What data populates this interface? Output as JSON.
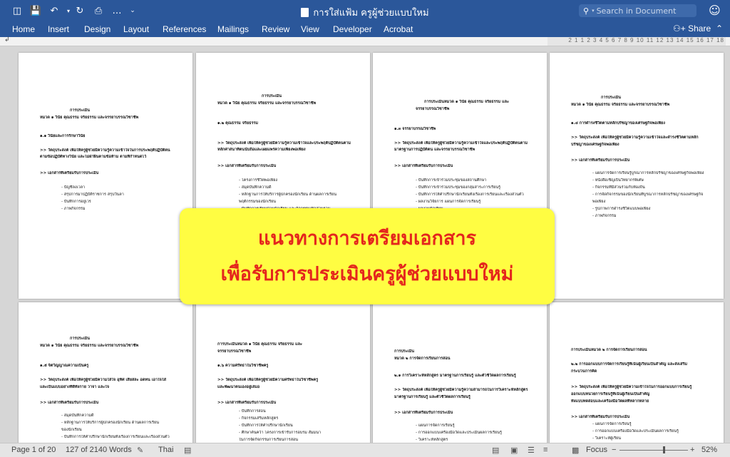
{
  "window": {
    "title": "การใส่แฟ้ม ครูผู้ช่วยแบบใหม่",
    "search_placeholder": "Search in Document",
    "quick_access": [
      "sidebar-toggle-icon",
      "save-icon",
      "undo-icon",
      "redo-icon",
      "print-icon",
      "customize-icon"
    ]
  },
  "ribbon": {
    "tabs": [
      "Home",
      "Insert",
      "Design",
      "Layout",
      "References",
      "Mailings",
      "Review",
      "View",
      "Developer",
      "Acrobat"
    ],
    "share_label": "Share"
  },
  "ruler": {
    "numbers": "2 1 1 2 3 4 5 6 7 8 9 10 11 12 13 14 15 16 17 18"
  },
  "pages": [
    {
      "lines": [
        {
          "t": "การประเมิน",
          "b": true
        },
        {
          "t": "หมวด ๑ วินัย คุณธรรม จริยธรรม และจรรยาบรรณวิชาชีพ",
          "b": true
        },
        {
          "t": "๑.๑ วินัยและการรักษาวินัย",
          "b": true
        },
        {
          "t": ">> วัตถุประสงค์    เพื่อให้ครูผู้ช่วยมีความรู้ความเข้าใจในการประพฤติปฏิบัติตน",
          "b": true
        },
        {
          "t": "ตามข้อปฏิบัติทางวินัย และไม่ฝ่าฝืนตามข้อห้าม ตามที่กำหนดไว้",
          "b": true
        },
        {
          "t": ">> เอกสารที่เตรียมรับการประเมิน",
          "b": true
        },
        {
          "t": "- บัญชีลงเวลา",
          "b": false
        },
        {
          "t": "- สรุปการมาปฏิบัติราชการ สรุปวันลา",
          "b": false
        },
        {
          "t": "- บันทึกการอยู่เวร",
          "b": false
        },
        {
          "t": "- ภาพกิจกรรม",
          "b": false
        }
      ]
    },
    {
      "lines": [
        {
          "t": "การประเมิน",
          "b": true
        },
        {
          "t": "หมวด ๑ วินัย คุณธรรม จริยธรรม และจรรยาบรรณวิชาชีพ",
          "b": true
        },
        {
          "t": "๑.๒ คุณธรรม จริยธรรม",
          "b": true
        },
        {
          "t": ">> วัตถุประสงค์    เพื่อให้ครูผู้ช่วยมีความรู้ความเข้าใจและประพฤติปฏิบัติตนตาม",
          "b": true
        },
        {
          "t": "หลักศาสนาที่ตนนับถือและเผยแพร่ความเพียงพอเพียง",
          "b": true
        },
        {
          "t": ">> เอกสารที่เตรียมรับการประเมิน",
          "b": true
        },
        {
          "t": "- โครงการชีวิตพอเพียง",
          "b": false
        },
        {
          "t": "- สมุดบันทึกความดี",
          "b": false
        },
        {
          "t": "- หลักฐานการให้บริการผู้ปกครองนักเรียน ด้านผลการเรียน",
          "b": false
        },
        {
          "t": "  พฤติกรรมของนักเรียน",
          "b": false
        },
        {
          "t": "- บันทึกการเยี่ยมบ้านนักเรียน และกิจกรรมเพื่อส่วนรวม",
          "b": false
        }
      ]
    },
    {
      "lines": [
        {
          "t": "การประเมินหมวด ๑ วินัย คุณธรรม จริยธรรม และ",
          "b": true
        },
        {
          "t": "จรรยาบรรณวิชาชีพ",
          "b": true
        },
        {
          "t": "๑.๓ จรรยาบรรณวิชาชีพ",
          "b": true
        },
        {
          "t": ">> วัตถุประสงค์    เพื่อให้ครูผู้ช่วยมีความรู้ความเข้าใจและประพฤติปฏิบัติตนตาม",
          "b": true
        },
        {
          "t": "มาตรฐานการปฏิบัติตน และจรรยาบรรณวิชาชีพ",
          "b": true
        },
        {
          "t": ">> เอกสารที่เตรียมรับการประเมิน",
          "b": true
        },
        {
          "t": "- บันทึกการเข้าร่วมประชุมของสถานศึกษา",
          "b": false
        },
        {
          "t": "- บันทึกการเข้าร่วมประชุมของกลุ่มสาระการเรียนรู้",
          "b": false
        },
        {
          "t": "- บันทึกการให้คำปรึกษานักเรียนทั้งเรื่องการเรียนและเรื่องส่วนตัว",
          "b": false
        },
        {
          "t": "- ผลงานวิจัยการ แผนการจัดการเรียนรู้",
          "b": false
        },
        {
          "t": "- ผลงานนักเรียน",
          "b": false
        }
      ]
    },
    {
      "lines": [
        {
          "t": "การประเมิน",
          "b": true
        },
        {
          "t": "หมวด ๑ วินัย คุณธรรม จริยธรรม และจรรยาบรรณวิชาชีพ",
          "b": true
        },
        {
          "t": "๑.๔ การดำรงชีวิตตามหลักปรัชญาของเศรษฐกิจพอเพียง",
          "b": true
        },
        {
          "t": ">> วัตถุประสงค์    เพื่อให้ครูผู้ช่วยมีความรู้ความเข้าใจและดำรงชีวิตตามหลัก",
          "b": true
        },
        {
          "t": "ปรัชญาของเศรษฐกิจพอเพียง",
          "b": true
        },
        {
          "t": ">> เอกสารที่เตรียมรับการประเมิน",
          "b": true
        },
        {
          "t": "- แผนการจัดการเรียนรู้บูรณาการหลักปรัชญาของเศรษฐกิจพอเพียง",
          "b": false
        },
        {
          "t": "- หนังสือเชิญเป็นวิทยากรพิเศษ",
          "b": false
        },
        {
          "t": "- กิจกรรมที่มีส่วนร่วมกับท้องถิ่น",
          "b": false
        },
        {
          "t": "- การจัดกิจกรรมของนักเรียนที่บูรณาการหลักปรัชญาของเศรษฐกิจ",
          "b": false
        },
        {
          "t": "  พอเพียง",
          "b": false
        },
        {
          "t": "- รูปภาพการดำรงชีวิตแบบพอเพียง",
          "b": false
        },
        {
          "t": "- ภาพกิจกรรม",
          "b": false
        }
      ]
    },
    {
      "lines": [
        {
          "t": "การประเมิน",
          "b": true
        },
        {
          "t": "หมวด ๑ วินัย คุณธรรม จริยธรรม และจรรยาบรรณวิชาชีพ",
          "b": true
        },
        {
          "t": "๑.๕ จิตวิญญาณความเป็นครู",
          "b": true
        },
        {
          "t": ">> วัตถุประสงค์    เพื่อให้ครูผู้ช่วยมีความใส่ใจ อุทิศ เสียสละ อดทน เอาใจใส่",
          "b": true
        },
        {
          "t": "และเป็นแบบอย่างที่ดีทั้งกาย วาจา และใจ",
          "b": true
        },
        {
          "t": ">> เอกสารที่เตรียมรับการประเมิน",
          "b": true
        },
        {
          "t": "- สมุดบันทึกความดี",
          "b": false
        },
        {
          "t": "- หลักฐานการให้บริการผู้ปกครองนักเรียน ด้านผลการเรียน",
          "b": false
        },
        {
          "t": "  ของนักเรียน",
          "b": false
        },
        {
          "t": "- บันทึกการให้คำปรึกษานักเรียนทั้งเรื่องการเรียนและเรื่องส่วนตัว",
          "b": false
        }
      ]
    },
    {
      "lines": [
        {
          "t": "การประเมินหมวด ๑ วินัย คุณธรรม จริยธรรม และ",
          "b": true
        },
        {
          "t": "จรรยาบรรณวิชาชีพ",
          "b": true
        },
        {
          "t": "๑.๖ ความศรัทธาในวิชาชีพครู",
          "b": true
        },
        {
          "t": ">> วัตถุประสงค์    เพื่อให้ครูผู้ช่วยมีความศรัทธาในวิชาชีพครู",
          "b": true
        },
        {
          "t": "และพัฒนาตนเองอยู่เสมอ",
          "b": true
        },
        {
          "t": ">> เอกสารที่เตรียมรับการประเมิน",
          "b": true
        },
        {
          "t": "- บันทึกการสอน",
          "b": false
        },
        {
          "t": "- กิจกรรมเสริมหลักสูตร",
          "b": false
        },
        {
          "t": "- บันทึกการให้คำปรึกษานักเรียน",
          "b": false
        },
        {
          "t": "- ศึกษาค้นคว้า โครงการเข้ารับการอบรม สัมมนา",
          "b": false
        },
        {
          "t": "  ในการจัดกิจกรรมการเรียนการสอน",
          "b": false
        }
      ]
    },
    {
      "lines": [
        {
          "t": "การประเมิน",
          "b": true
        },
        {
          "t": "หมวด ๒ การจัดการเรียนการสอน",
          "b": true
        },
        {
          "t": "๒.๑ การวิเคราะห์หลักสูตร มาตรฐานการเรียนรู้ และตัวชี้วัดผลการเรียนรู้",
          "b": true
        },
        {
          "t": ">> วัตถุประสงค์    เพื่อให้ครูผู้ช่วยมีความรู้ความสามารถในการวิเคราะห์หลักสูตร",
          "b": true
        },
        {
          "t": "มาตรฐานการเรียนรู้ และตัวชี้วัดผลการเรียนรู้",
          "b": true
        },
        {
          "t": ">> เอกสารที่เตรียมรับการประเมิน",
          "b": true
        },
        {
          "t": "- แผนการจัดการเรียนรู้",
          "b": false
        },
        {
          "t": "- การออกแบบเครื่องมือวัดและประเมินผลการเรียนรู้",
          "b": false
        },
        {
          "t": "- วิเคราะห์หลักสูตร",
          "b": false
        }
      ]
    },
    {
      "lines": [
        {
          "t": "การประเมินหมวด ๒ การจัดการเรียนการสอน",
          "b": true
        },
        {
          "t": "๒.๒ การออกแบบการจัดการเรียนรู้ที่เน้นผู้เรียนเป็นสำคัญ และส่งเสริม",
          "b": true
        },
        {
          "t": "กระบวนการคิด",
          "b": true
        },
        {
          "t": ">> วัตถุประสงค์    เพื่อให้ครูผู้ช่วยมีความเข้าใจในการออกแบบการเรียนรู้",
          "b": true
        },
        {
          "t": "ออกแบบหน่วยการเรียนรู้ที่เน้นผู้เรียนเป็นสำคัญ",
          "b": true
        },
        {
          "t": "ทั้งแบบทดสอบและเครื่องมือวัดผลที่หลากหลาย",
          "b": true
        },
        {
          "t": ">> เอกสารที่เตรียมรับการประเมิน",
          "b": true
        },
        {
          "t": "- แผนการจัดการเรียนรู้",
          "b": false
        },
        {
          "t": "- การออกแบบเครื่องมือวัดและประเมินผลการเรียนรู้",
          "b": false
        },
        {
          "t": "- วิเคราะห์ผู้เรียน",
          "b": false
        }
      ]
    }
  ],
  "banner": {
    "line1": "แนวทางการเตรียมเอกสาร",
    "line2": "เพื่อรับการประเมินครูผู้ช่วยแบบใหม่",
    "bg_color": "#fffd42",
    "text_color": "#e4261d"
  },
  "status": {
    "page": "Page 1 of 20",
    "words": "127 of 2140 Words",
    "language": "Thai",
    "focus": "Focus",
    "zoom": "52%"
  },
  "colors": {
    "ribbon": "#2b579a",
    "canvas": "#d6d6d6"
  }
}
